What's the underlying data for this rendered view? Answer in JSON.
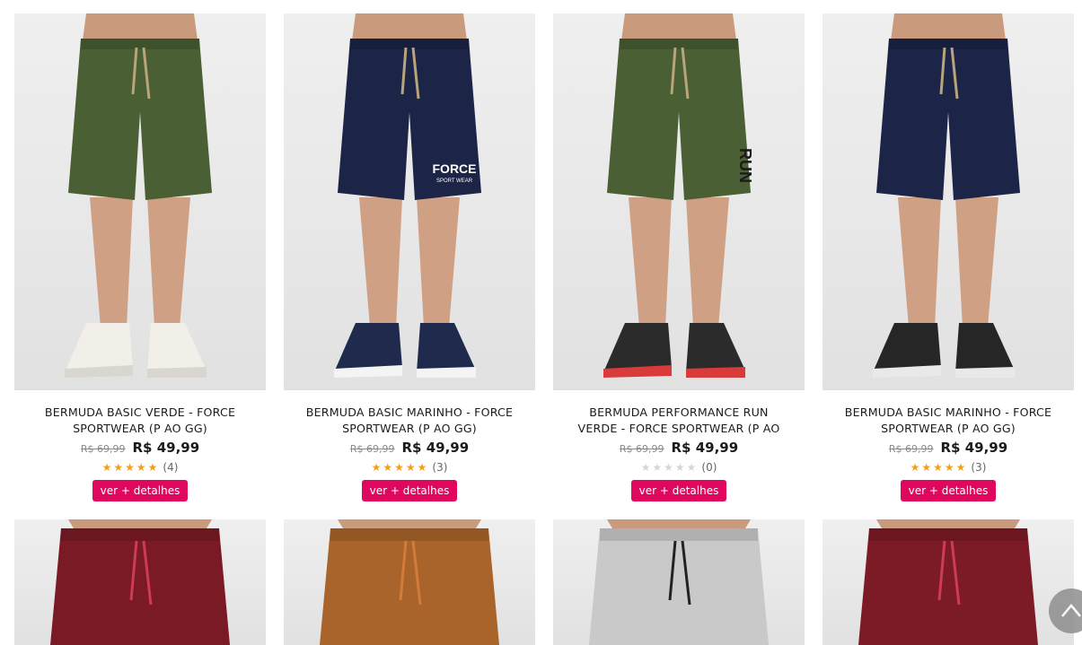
{
  "products": [
    {
      "title": "BERMUDA BASIC VERDE - FORCE SPORTWEAR (P AO GG)",
      "old_price": "R$ 69,99",
      "price": "R$ 49,99",
      "rating": 5,
      "reviews": "(4)",
      "button": "ver + detalhes",
      "short_color": "#4b5f34",
      "shoe": "white"
    },
    {
      "title": "BERMUDA BASIC MARINHO - FORCE SPORTWEAR (P AO GG)",
      "old_price": "R$ 69,99",
      "price": "R$ 49,99",
      "rating": 5,
      "reviews": "(3)",
      "button": "ver + detalhes",
      "short_color": "#1c2547",
      "shoe": "navy",
      "logo_text": "FORCE",
      "logo_sub": "SPORT WEAR"
    },
    {
      "title": "BERMUDA PERFORMANCE RUN VERDE - FORCE SPORTWEAR (P AO GG)",
      "old_price": "R$ 69,99",
      "price": "R$ 49,99",
      "rating": 0,
      "reviews": "(0)",
      "button": "ver + detalhes",
      "short_color": "#4b5f34",
      "shoe": "black-red",
      "side_text": "RUN"
    },
    {
      "title": "BERMUDA BASIC MARINHO - FORCE SPORTWEAR (P AO GG)",
      "old_price": "R$ 69,99",
      "price": "R$ 49,99",
      "rating": 5,
      "reviews": "(3)",
      "button": "ver + detalhes",
      "short_color": "#1c2547",
      "shoe": "black"
    }
  ],
  "second_row": [
    {
      "short_color": "#7a1a25",
      "cord": "#cf3a55"
    },
    {
      "short_color": "#a8642a",
      "cord": "#d37c3a"
    },
    {
      "short_color": "#c9c9c9",
      "cord": "#222222"
    },
    {
      "short_color": "#7c1a26",
      "cord": "#cf3a55"
    }
  ],
  "scroll_top_icon": "chevron-up-icon"
}
